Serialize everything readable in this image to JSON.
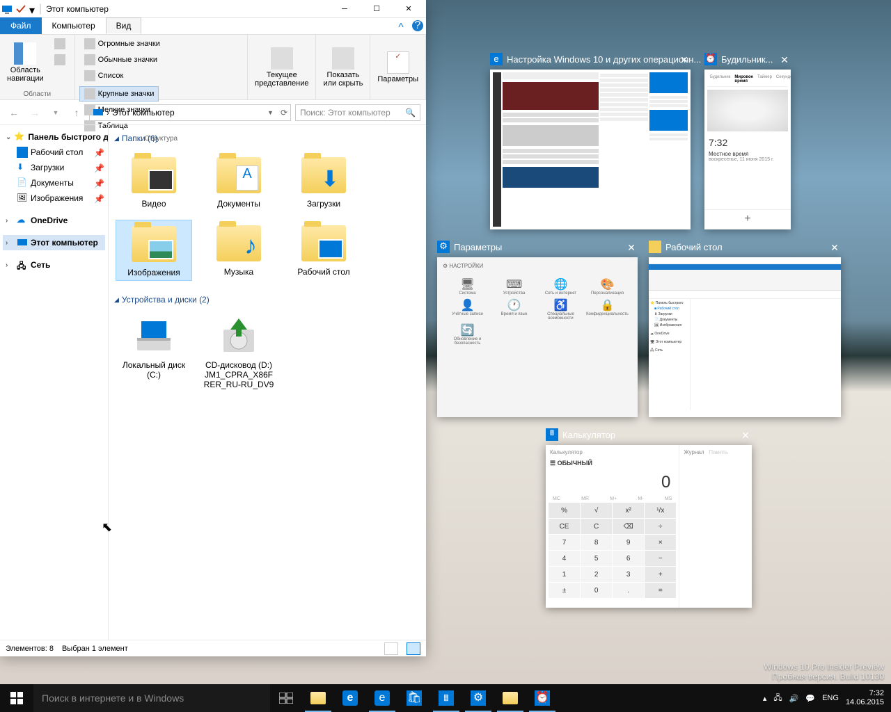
{
  "explorer": {
    "title": "Этот компьютер",
    "tabs": {
      "file": "Файл",
      "computer": "Компьютер",
      "view": "Вид"
    },
    "ribbon": {
      "nav_pane": "Область\nнавигации",
      "nav_group": "Области",
      "layout_group": "Структура",
      "layout_opts": {
        "huge": "Огромные значки",
        "large": "Крупные значки",
        "normal": "Обычные значки",
        "small": "Мелкие значки",
        "list": "Список",
        "table": "Таблица"
      },
      "current_view": "Текущее\nпредставление",
      "show_hide": "Показать\nили скрыть",
      "params": "Параметры"
    },
    "breadcrumb": "Этот компьютер",
    "search_placeholder": "Поиск: Этот компьютер",
    "nav": {
      "quick": "Панель быстрого дс",
      "desktop": "Рабочий стол",
      "downloads": "Загрузки",
      "documents": "Документы",
      "pictures": "Изображения",
      "onedrive": "OneDrive",
      "thispc": "Этот компьютер",
      "network": "Сеть"
    },
    "sections": {
      "folders": "Папки (6)",
      "drives": "Устройства и диски (2)"
    },
    "folders": {
      "video": "Видео",
      "documents": "Документы",
      "downloads": "Загрузки",
      "pictures": "Изображения",
      "music": "Музыка",
      "desktop": "Рабочий стол"
    },
    "drives": {
      "c": "Локальный диск (C:)",
      "d": "CD-дисковод (D:) JM1_CPRA_X86FRER_RU-RU_DV9"
    },
    "status": {
      "count": "Элементов: 8",
      "selected": "Выбран 1 элемент"
    }
  },
  "taskview": {
    "browser": "Настройка Windows 10 и других операционн...",
    "alarms": "Будильник...",
    "alarms_body": {
      "time": "7:32",
      "local": "Местное время",
      "date": "воскресенье, 11 июня 2015 г."
    },
    "settings": "Параметры",
    "settings_body": {
      "header": "НАСТРОЙКИ",
      "system": "Система",
      "devices": "Устройства",
      "network": "Сеть и интернет",
      "personalize": "Персонализация",
      "accounts": "Учётные записи",
      "time": "Время и язык",
      "access": "Специальные возможности",
      "privacy": "Конфиденциальность",
      "update": "Обновление и безопасность"
    },
    "desktop_fe": "Рабочий стол",
    "calc": "Калькулятор",
    "calc_body": {
      "title": "Калькулятор",
      "mode": "ОБЫЧНЫЙ",
      "display": "0",
      "journal": "Журнал",
      "memory": "Память"
    }
  },
  "taskbar": {
    "search": "Поиск в интернете и в Windows",
    "lang": "ENG",
    "time": "7:32",
    "date": "14.06.2015"
  },
  "watermark": {
    "l1": "Windows 10 Pro Insider Preview",
    "l2": "Пробная версия. Build 10130"
  },
  "calc_keys": [
    "%",
    "√",
    "x²",
    "¹/x",
    "CE",
    "C",
    "⌫",
    "÷",
    "7",
    "8",
    "9",
    "×",
    "4",
    "5",
    "6",
    "−",
    "1",
    "2",
    "3",
    "+",
    "±",
    "0",
    ".",
    "="
  ]
}
